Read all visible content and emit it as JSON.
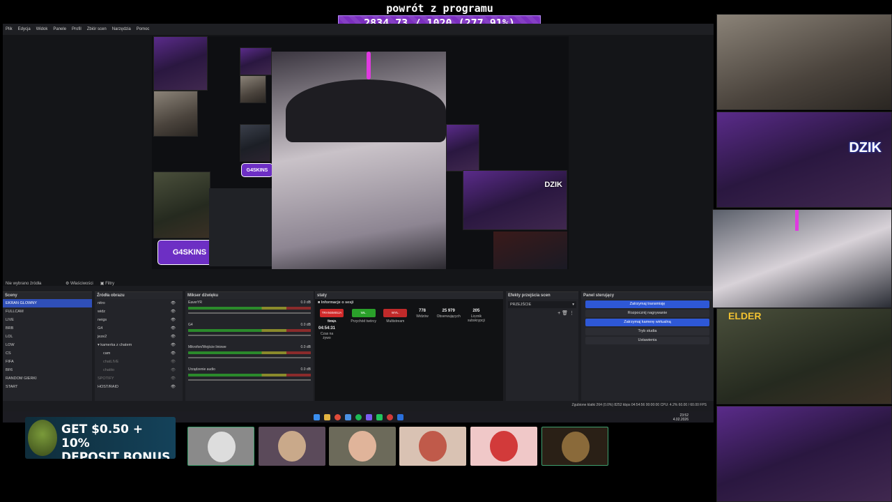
{
  "overlay": {
    "title": "powrót z programu",
    "progress_text": "2834.73 / 1020 (277.91%)"
  },
  "menu": [
    "Plik",
    "Edycja",
    "Widok",
    "Panele",
    "Profil",
    "Zbiór scen",
    "Narzędzia",
    "Pomoc"
  ],
  "preview": {
    "logo_badge": "G4SKINS",
    "dzik_brand": "DZIK",
    "small_badge": "G4SKINS"
  },
  "source_toolbar": {
    "no_source": "Nie wybrano źródła",
    "properties_tab": "Właściwości",
    "filters_tab": "Filtry"
  },
  "scenes": {
    "header": "Sceny",
    "items": [
      "EKRAN GLOWNY",
      "FULLCAM",
      "LIVE",
      "BRB",
      "LOL",
      "LOW",
      "CS",
      "FIFA",
      "BF6",
      "RANDOM GIERKI",
      "START"
    ]
  },
  "sources": {
    "header": "Źródła obrazu",
    "items": [
      "nitro",
      "widz",
      "neigs",
      "G4",
      "jeze2",
      "kamerka z chatem",
      "cam",
      "chatLIVE",
      "chatito",
      "SPOTIFY",
      "HOST/RAID"
    ]
  },
  "mixer": {
    "header": "Mikser dźwięku",
    "items": [
      {
        "name": "EaverYR",
        "db": "0.0 dB"
      },
      {
        "name": "G4",
        "db": "0.0 dB"
      },
      {
        "name": "Mikrofon/Wejście liniowe",
        "db": "0.0 dB"
      },
      {
        "name": "Urządzenie audio",
        "db": "0.0 dB"
      }
    ]
  },
  "stats": {
    "dock_header": "staty",
    "section": "Informacje o sesji",
    "items": [
      {
        "value": "",
        "label": "Sesja",
        "pill": "TRANSMISJA TRWA",
        "pill_color": "#d02a2a"
      },
      {
        "value": "",
        "label": "Przychód twórcy",
        "pill": "WŁ.",
        "pill_color": "#2aa02a"
      },
      {
        "value": "",
        "label": "Multistream",
        "pill": "WYŁ.",
        "pill_color": "#c02a2a"
      },
      {
        "value": "778",
        "label": "Widzów",
        "pill": "",
        "pill_color": ""
      },
      {
        "value": "25 979",
        "label": "Obserwujących",
        "pill": "",
        "pill_color": ""
      },
      {
        "value": "205",
        "label": "Licznik subskrypcji",
        "pill": "",
        "pill_color": ""
      },
      {
        "value": "04:54:31",
        "label": "Czas na żywo",
        "pill": "",
        "pill_color": ""
      }
    ]
  },
  "transitions": {
    "header": "Efekty przejścia scen",
    "selected": "PRZEJŚCIE"
  },
  "controls": {
    "header": "Panel sterujący",
    "buttons": [
      {
        "label": "Zatrzymaj transmisję",
        "active": true
      },
      {
        "label": "Rozpocznij nagrywanie",
        "active": false
      },
      {
        "label": "Zatrzymaj kamerę wirtualną",
        "active": true
      },
      {
        "label": "Tryb studia",
        "active": false
      },
      {
        "label": "Ustawienia",
        "active": false
      }
    ]
  },
  "status_bar": {
    "text": "Zgubione klatki 264 (0.0%)   8252 kbps   04:54:56   00:00:00   CPU: 4.2%   60.00 / 60.00 FPS"
  },
  "clock": {
    "time": "23:52",
    "date": "4.02.2026"
  },
  "webcam_labels": {
    "dzik_sign": "DZIK",
    "elder_sign": "ELDER"
  },
  "ad": {
    "line1": "GET $0.50 + 10%",
    "line2": "DEPOSIT BONUS"
  },
  "colors": {
    "accent": "#2e58d6",
    "overlay_purple": "#7b2fbf"
  }
}
